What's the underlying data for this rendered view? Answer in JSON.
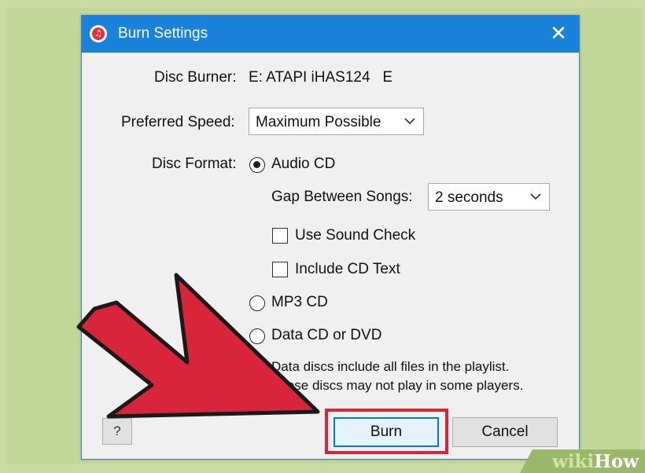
{
  "dialog": {
    "title": "Burn Settings",
    "close_glyph": "✕",
    "app_icon": "itunes-icon",
    "app_icon_glyph": "♫"
  },
  "disc_burner": {
    "label": "Disc Burner:",
    "value": "E: ATAPI iHAS124   E"
  },
  "preferred_speed": {
    "label": "Preferred Speed:",
    "value": "Maximum Possible"
  },
  "disc_format": {
    "label": "Disc Format:",
    "options": [
      {
        "label": "Audio CD",
        "selected": true
      },
      {
        "label": "MP3 CD",
        "selected": false
      },
      {
        "label": "Data CD or DVD",
        "selected": false
      }
    ]
  },
  "audio_cd": {
    "gap_label": "Gap Between Songs:",
    "gap_value": "2 seconds",
    "use_sound_check": {
      "label": "Use Sound Check",
      "checked": false
    },
    "include_cd_text": {
      "label": "Include CD Text",
      "checked": false
    }
  },
  "data_note": {
    "line1": "Data discs include all files in the playlist.",
    "line2": "These discs may not play in some players."
  },
  "buttons": {
    "help": "?",
    "burn": "Burn",
    "cancel": "Cancel"
  },
  "annotation": {
    "arrow_color": "#d9253a",
    "highlight_color": "#d9253a"
  },
  "watermark": {
    "wiki": "wiki",
    "how": "How"
  },
  "colors": {
    "titlebar": "#1a82d9",
    "dialog_bg": "#f0f0f0",
    "page_bg": "#c2d79a"
  }
}
